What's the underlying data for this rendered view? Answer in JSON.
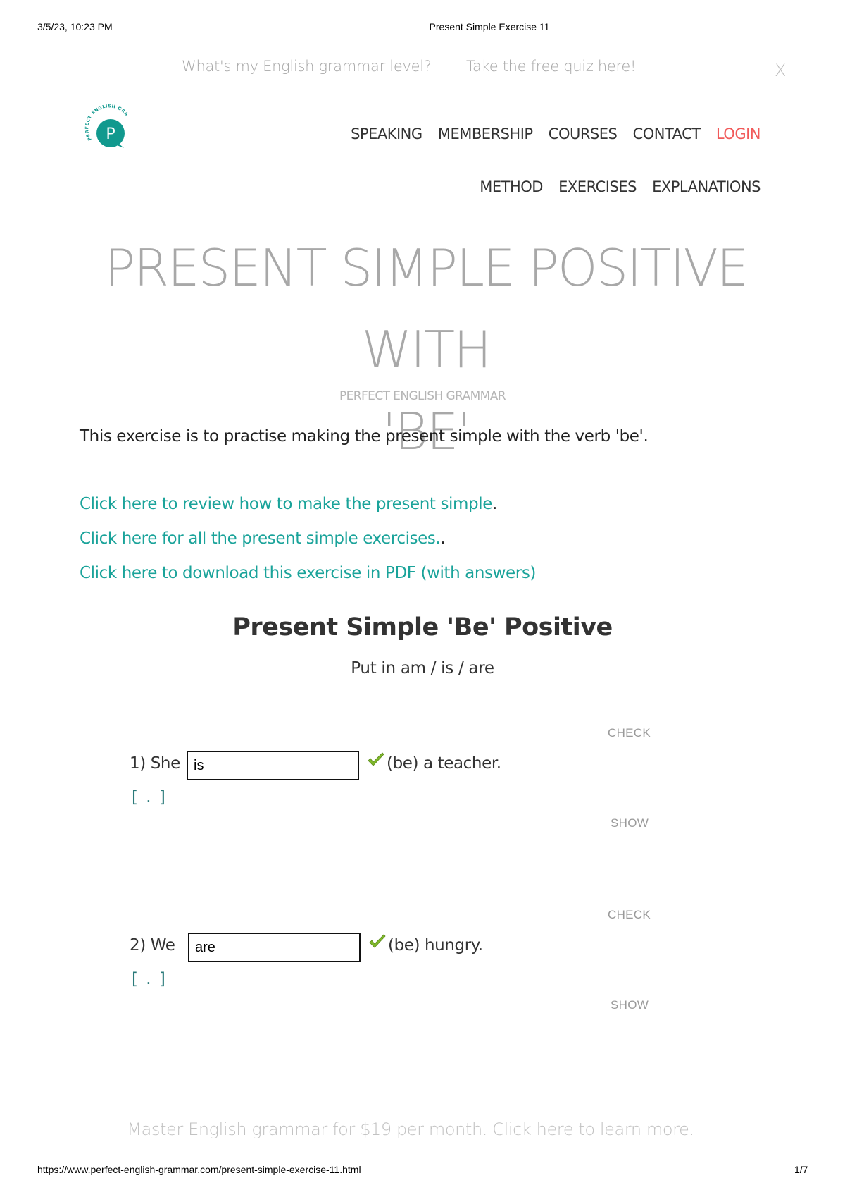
{
  "print_header": {
    "datetime": "3/5/23, 10:23 PM",
    "title": "Present Simple Exercise 11"
  },
  "promo_bar": {
    "question": "What's my English grammar level?",
    "cta": "Take the free quiz here!",
    "close_label": "X"
  },
  "logo": {
    "letter": "P",
    "ring_text": "PERFECT ENGLISH GRAMMAR",
    "color": "#11998e"
  },
  "nav": {
    "primary": [
      {
        "label": "SPEAKING"
      },
      {
        "label": "MEMBERSHIP"
      },
      {
        "label": "COURSES"
      },
      {
        "label": "CONTACT"
      },
      {
        "label": "LOGIN"
      }
    ],
    "secondary": [
      {
        "label": "METHOD"
      },
      {
        "label": "EXERCISES"
      },
      {
        "label": "EXPLANATIONS"
      }
    ],
    "login_color": "#f15a5a"
  },
  "page": {
    "title_line1": "PRESENT SIMPLE POSITIVE WITH",
    "title_line2": "'BE'",
    "subtitle": "PERFECT ENGLISH GRAMMAR",
    "intro": "This exercise is to practise making the present simple with the verb 'be'."
  },
  "links": [
    {
      "text": "Click here to review how to make the present simple",
      "suffix": "."
    },
    {
      "text": "Click here for all the present simple exercises.",
      "suffix": "."
    },
    {
      "text": "Click here to download this exercise in PDF (with answers)",
      "suffix": ""
    }
  ],
  "link_color": "#1aa39a",
  "exercise": {
    "title": "Present Simple 'Be' Positive",
    "instruction": "Put in am / is / are",
    "questions": [
      {
        "number_subject": "1) She",
        "answer_value": "is",
        "status": "correct",
        "tail": "(be) a teacher.",
        "answer_toggle": "[ . ]",
        "check_label": "CHECK",
        "show_label": "SHOW"
      },
      {
        "number_subject": "2) We",
        "answer_value": "are",
        "status": "correct",
        "tail": "(be) hungry.",
        "answer_toggle": "[ . ]",
        "check_label": "CHECK",
        "show_label": "SHOW"
      }
    ]
  },
  "bottom_promo": "Master English grammar for $19 per month. Click here to learn more.",
  "print_footer": {
    "url": "https://www.perfect-english-grammar.com/present-simple-exercise-11.html",
    "page": "1/7"
  }
}
